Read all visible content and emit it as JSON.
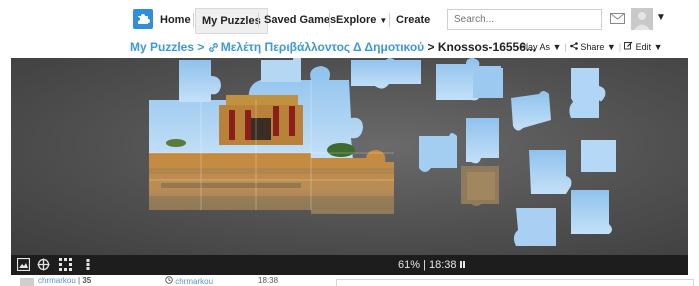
{
  "nav": {
    "home": "Home",
    "my_puzzles": "My Puzzles",
    "saved_games": "Saved Games",
    "explore": "Explore",
    "create": "Create",
    "search_placeholder": "Search...",
    "icons": [
      "puzzle-logo-icon",
      "mail-icon",
      "avatar",
      "chevron-down-icon"
    ]
  },
  "breadcrumb": {
    "root": "My Puzzles",
    "sep": ">",
    "folder": "Μελέτη Περιβάλλοντος Δ Δημοτικού",
    "current": "Knossos-16556..."
  },
  "actions": {
    "play_as": "Play As",
    "share": "Share",
    "edit": "Edit"
  },
  "status": {
    "progress": "61%",
    "divider": "|",
    "time": "18:38"
  },
  "footer": {
    "user": "chrmarkou",
    "score": "35",
    "owner": "chrmarkou",
    "time": "18:38"
  },
  "colors": {
    "accent": "#3d9ad8",
    "board_bg": "#555555",
    "statusbar_bg": "#1d1d1d",
    "piece_sky": "#a9d0f2"
  }
}
